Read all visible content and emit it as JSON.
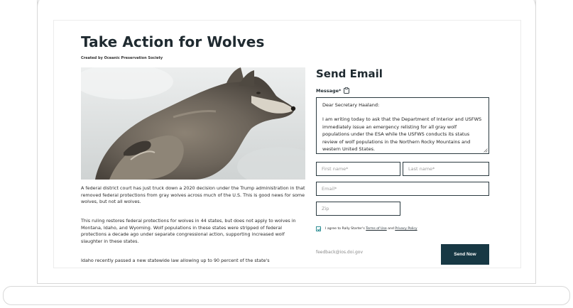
{
  "page": {
    "title": "Take Action for Wolves",
    "creator": "Created by Oceanic Preservation Society",
    "body_paragraphs": [
      "A federal district court has just truck down a 2020 decision under the Trump administration in that removed federal protections from gray wolves across much of the U.S. This is good news for some wolves, but not all wolves.",
      "This ruling restores federal protections for wolves in 44 states, but does not apply to wolves in Montana, Idaho, and Wyoming. Wolf populations in these states were stripped of federal protections a decade ago under separate congressional action, supporting increased wolf slaughter in these states.",
      "Idaho recently passed a new statewide law allowing up to 90 percent of the state's"
    ]
  },
  "form": {
    "heading": "Send Email",
    "message_label": "Message*",
    "message_lines": [
      "Dear Secretary Haaland:",
      "I am writing today to ask that the Department of Interior and USFWS  immediately issue an emergency relisting for all gray wolf populations under the ESA while the USFWS conducts its status review of wolf populations in the Northern Rocky Mountains and western United States."
    ],
    "first_name_placeholder": "First name*",
    "last_name_placeholder": "Last name*",
    "email_placeholder": "Email*",
    "zip_placeholder": "Zip",
    "consent_prefix": "I agree to Rally Starter's ",
    "terms_link": "Terms of Use",
    "consent_and": " and ",
    "privacy_link": "Privacy Policy",
    "consent_checked": true,
    "recipient": "feedback@ios.doi.gov",
    "submit_label": "Send Now"
  },
  "colors": {
    "accent": "#173844",
    "checkbox": "#2f8f95",
    "heading": "#1f2a30"
  }
}
